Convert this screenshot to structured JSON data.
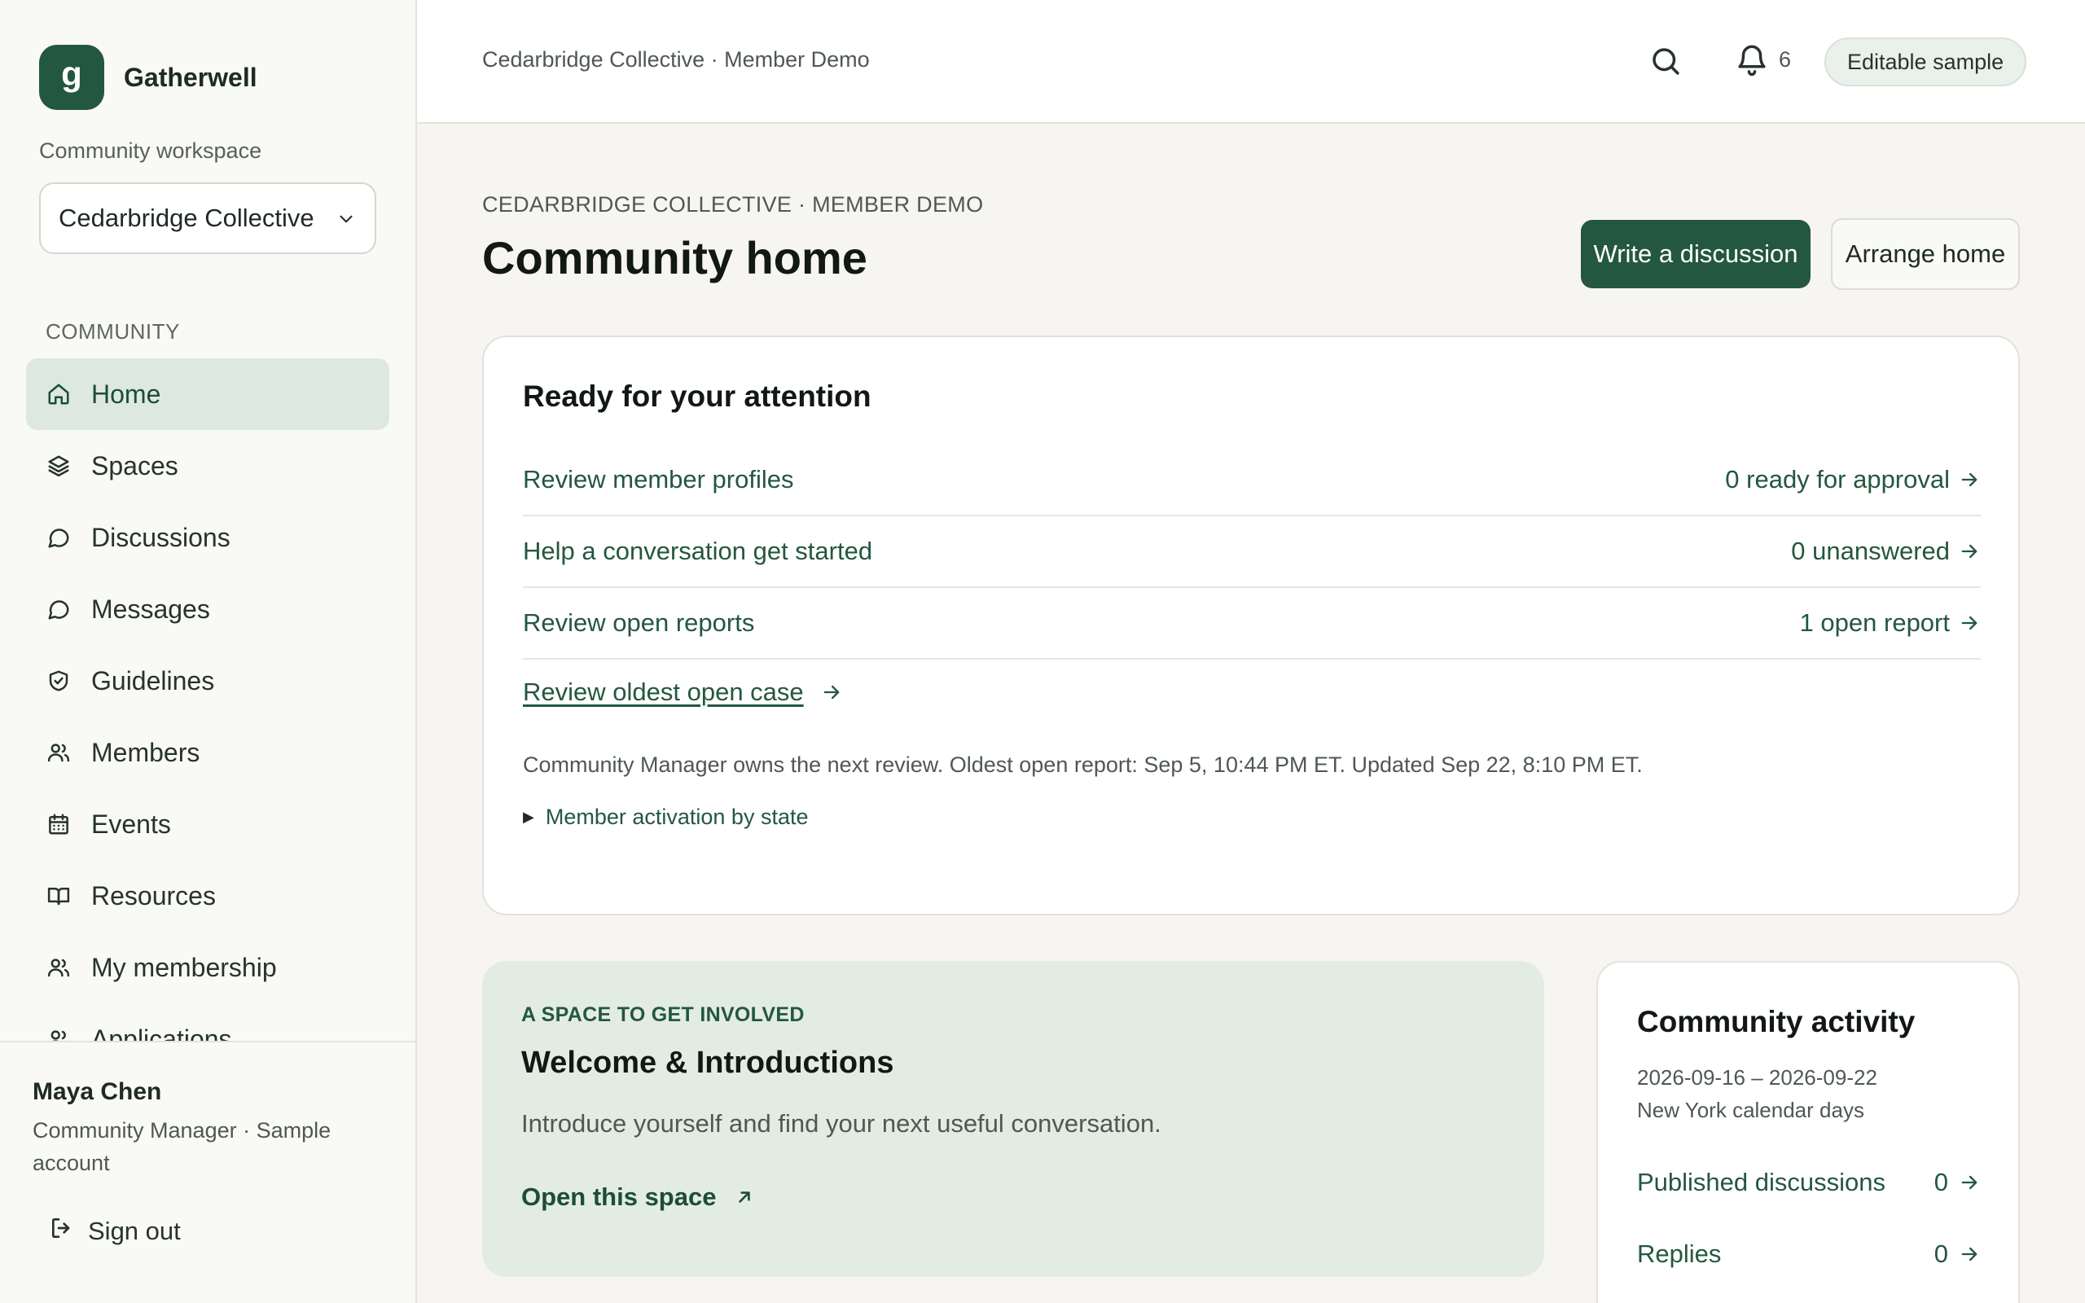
{
  "brand": {
    "initial": "g",
    "name": "Gatherwell"
  },
  "workspace": {
    "label": "Community workspace",
    "selected": "Cedarbridge Collective · Member Demo"
  },
  "nav": {
    "heading": "COMMUNITY",
    "items": [
      {
        "label": "Home",
        "icon": "home-icon",
        "active": true
      },
      {
        "label": "Spaces",
        "icon": "layers-icon"
      },
      {
        "label": "Discussions",
        "icon": "chat-bubble-icon"
      },
      {
        "label": "Messages",
        "icon": "message-icon"
      },
      {
        "label": "Guidelines",
        "icon": "shield-check-icon"
      },
      {
        "label": "Members",
        "icon": "people-icon"
      },
      {
        "label": "Events",
        "icon": "calendar-icon"
      },
      {
        "label": "Resources",
        "icon": "book-icon"
      },
      {
        "label": "My membership",
        "icon": "people-icon"
      },
      {
        "label": "Applications",
        "icon": "people-icon"
      }
    ]
  },
  "user": {
    "name": "Maya Chen",
    "role": "Community Manager · Sample account",
    "sign_out": "Sign out"
  },
  "topbar": {
    "breadcrumb": "Cedarbridge Collective · Member Demo",
    "notification_count": "6",
    "pill": "Editable sample"
  },
  "header": {
    "eyebrow": "CEDARBRIDGE COLLECTIVE · MEMBER DEMO",
    "title": "Community home",
    "primary_button": "Write a discussion",
    "secondary_button": "Arrange home"
  },
  "attention": {
    "title": "Ready for your attention",
    "tasks": [
      {
        "label": "Review member profiles",
        "status": "0 ready for approval"
      },
      {
        "label": "Help a conversation get started",
        "status": "0 unanswered"
      },
      {
        "label": "Review open reports",
        "status": "1 open report"
      }
    ],
    "case_link": "Review oldest open case",
    "note": "Community Manager owns the next review. Oldest open report: Sep 5, 10:44 PM ET. Updated Sep 22, 8:10 PM ET.",
    "disclosure": "Member activation by state"
  },
  "space": {
    "eyebrow": "A SPACE TO GET INVOLVED",
    "title": "Welcome & Introductions",
    "description": "Introduce yourself and find your next useful conversation.",
    "link": "Open this space"
  },
  "activity": {
    "title": "Community activity",
    "range": "2026-09-16 – 2026-09-22",
    "timezone": "New York calendar days",
    "rows": [
      {
        "label": "Published discussions",
        "value": "0"
      },
      {
        "label": "Replies",
        "value": "0"
      }
    ]
  },
  "colors": {
    "accent": "#24573f",
    "accent_soft": "#e3ece3",
    "background": "#f6f5f1"
  }
}
